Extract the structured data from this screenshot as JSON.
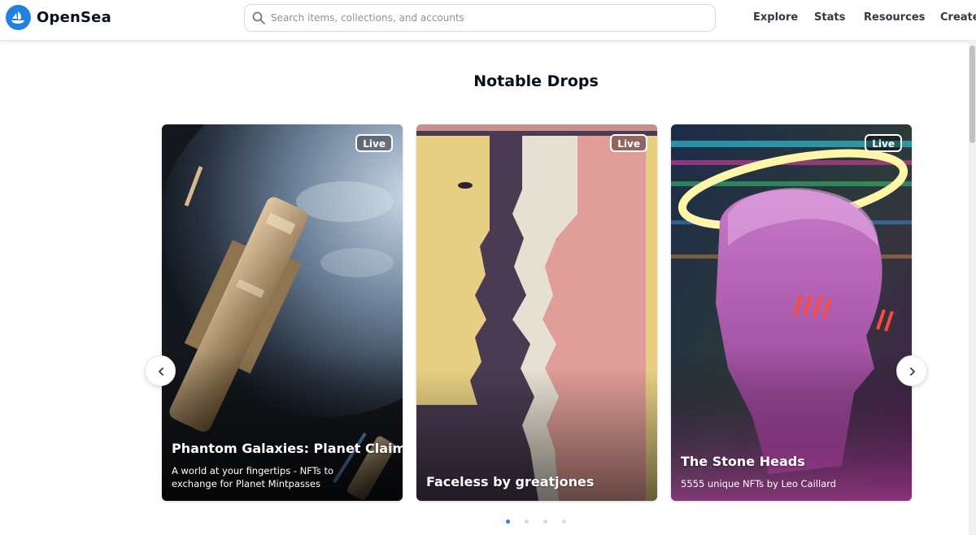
{
  "header": {
    "brand": "OpenSea",
    "search": {
      "placeholder": "Search items, collections, and accounts",
      "value": ""
    },
    "nav": [
      "Explore",
      "Stats",
      "Resources",
      "Create"
    ]
  },
  "section": {
    "title": "Notable Drops"
  },
  "cards": [
    {
      "badge": "Live",
      "title": "Phantom Galaxies: Planet Claim",
      "description": "A world at your fingertips - NFTs to exchange for Planet Mintpasses"
    },
    {
      "badge": "Live",
      "title": "Faceless by greatjones",
      "description": ""
    },
    {
      "badge": "Live",
      "title": "The Stone Heads",
      "description": "5555 unique NFTs by Leo Caillard"
    }
  ],
  "carousel": {
    "current_page": 1,
    "total_pages": 4
  },
  "colors": {
    "accent": "#2081e2",
    "text": "#04111d"
  }
}
